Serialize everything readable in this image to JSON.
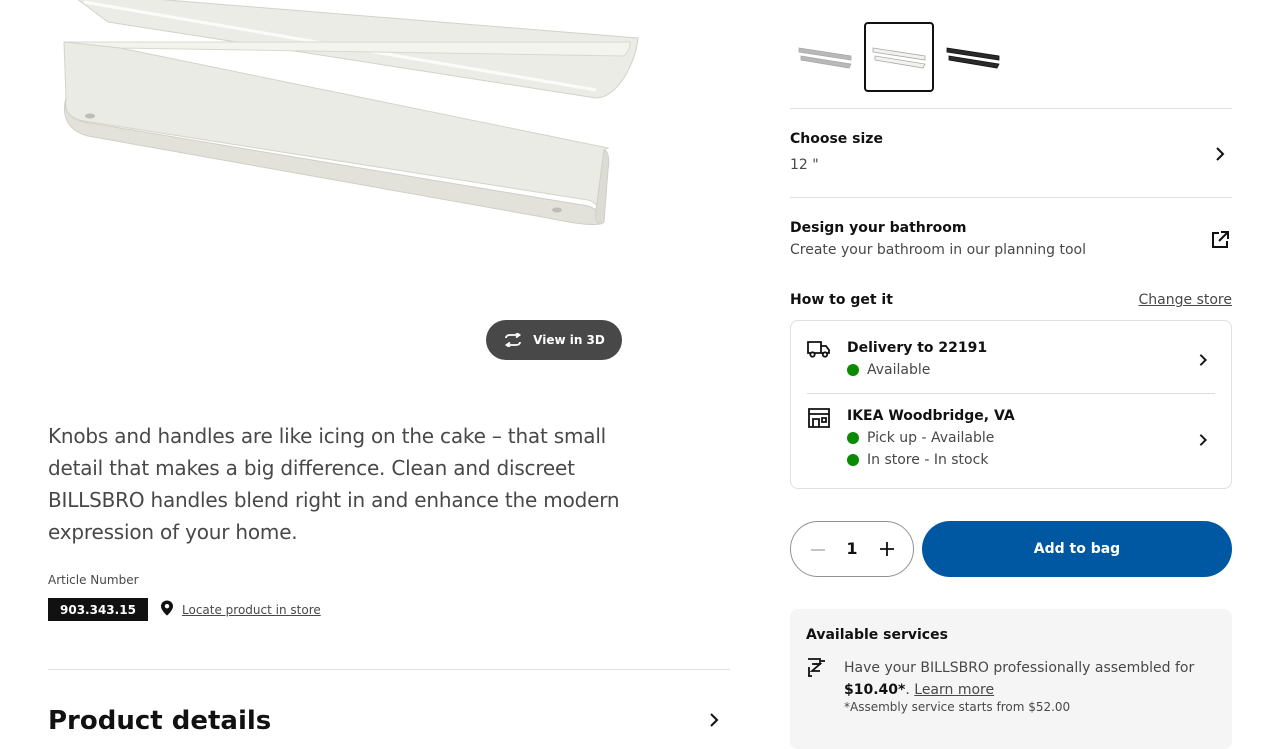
{
  "gallery": {
    "image_alt": "BILLSBRO handles, white",
    "view_3d_label": "View in 3D"
  },
  "description": "Knobs and handles are like icing on the cake – that small detail that makes a big difference. Clean and discreet BILLSBRO handles blend right in and enhance the modern expression of your home.",
  "article": {
    "label": "Article Number",
    "number": "903.343.15",
    "locate_link": "Locate product in store"
  },
  "product_details": {
    "heading": "Product details"
  },
  "color_options": [
    {
      "name": "stainless steel colour",
      "color": "#b8b8b8",
      "selected": false
    },
    {
      "name": "white",
      "color": "#f3f3ee",
      "selected": true
    },
    {
      "name": "black",
      "color": "#2a2a2a",
      "selected": false
    }
  ],
  "size": {
    "title": "Choose size",
    "value": "12 \""
  },
  "design": {
    "title": "Design your bathroom",
    "subtitle": "Create your bathroom in our planning tool"
  },
  "how_to_get": {
    "title": "How to get it",
    "change_store": "Change store",
    "delivery": {
      "title": "Delivery to 22191",
      "status": "Available",
      "status_color": "#0a8a00"
    },
    "store": {
      "title": "IKEA Woodbridge, VA",
      "pickup": "Pick up - Available",
      "in_store": "In store - In stock",
      "status_color": "#0a8a00"
    }
  },
  "purchase": {
    "quantity": "1",
    "add_to_bag": "Add to bag",
    "button_color": "#0058a3"
  },
  "services": {
    "title": "Available services",
    "text_prefix": "Have your BILLSBRO professionally assembled for",
    "price": "$10.40*",
    "text_suffix": ".",
    "learn_more": "Learn more",
    "note": "*Assembly service starts from $52.00"
  },
  "icons": [
    "rotate-3d-icon",
    "location-pin-icon",
    "chevron-right-icon",
    "external-link-icon",
    "delivery-truck-icon",
    "store-icon",
    "minus-icon",
    "plus-icon",
    "assembly-icon"
  ]
}
